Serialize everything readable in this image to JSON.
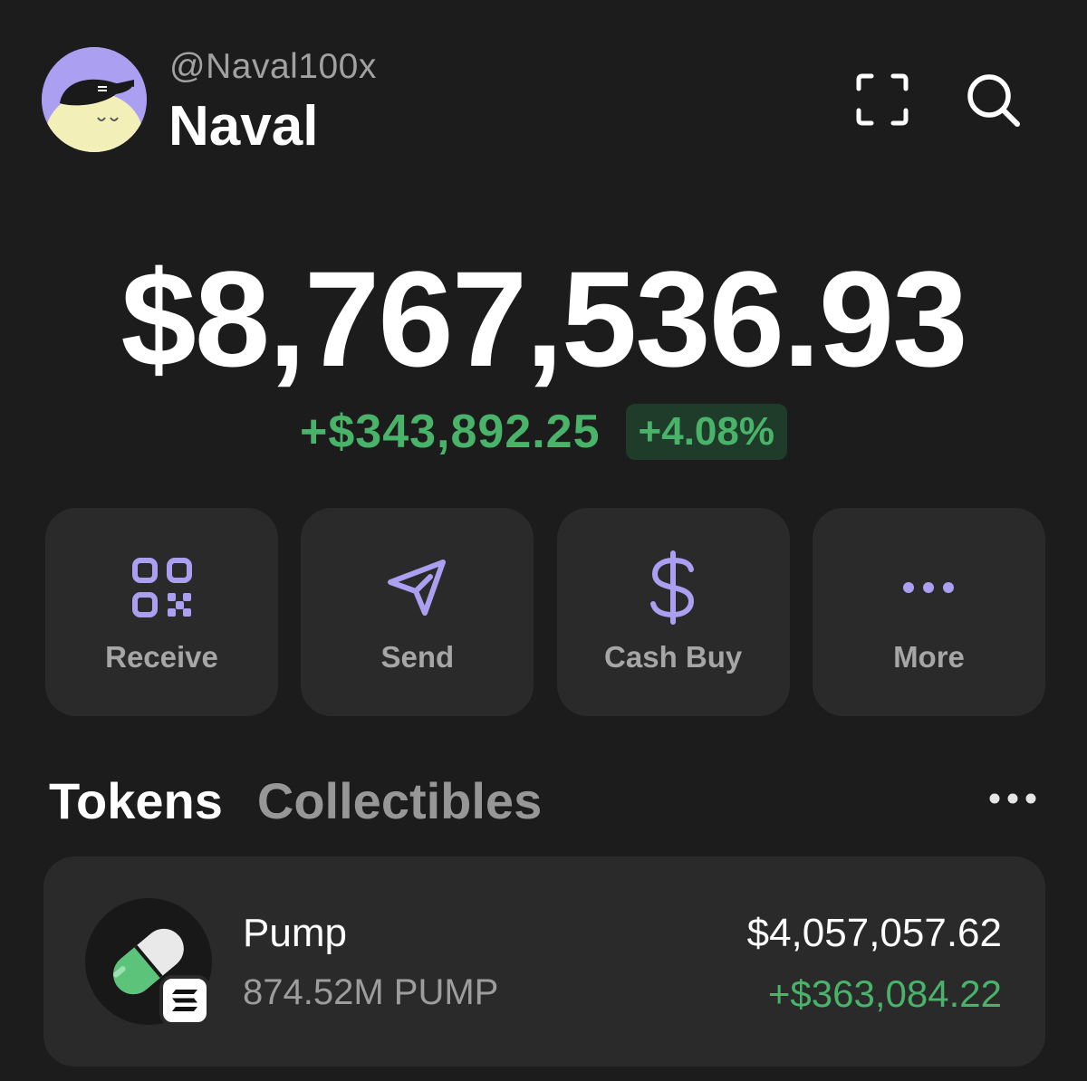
{
  "profile": {
    "handle": "@Naval100x",
    "name": "Naval",
    "avatar_icon": "avatar-hat-character-icon"
  },
  "header_icons": [
    "scan-icon",
    "search-icon"
  ],
  "balance": {
    "total": "$8,767,536.93",
    "change_amount": "+$343,892.25",
    "change_percent": "+4.08%"
  },
  "actions": [
    {
      "label": "Receive",
      "icon": "qr-code-icon"
    },
    {
      "label": "Send",
      "icon": "send-arrow-icon"
    },
    {
      "label": "Cash Buy",
      "icon": "dollar-icon"
    },
    {
      "label": "More",
      "icon": "more-dots-icon"
    }
  ],
  "tabs": [
    {
      "label": "Tokens",
      "active": true
    },
    {
      "label": "Collectibles",
      "active": false
    }
  ],
  "tokens": [
    {
      "name": "Pump",
      "quantity": "874.52M PUMP",
      "value": "$4,057,057.62",
      "change": "+$363,084.22",
      "logo_icon": "pill-icon",
      "chain_icon": "solana-icon"
    }
  ],
  "colors": {
    "background": "#1c1c1c",
    "card": "#2a2a2a",
    "accent": "#ab9ff2",
    "positive": "#49b36a"
  }
}
